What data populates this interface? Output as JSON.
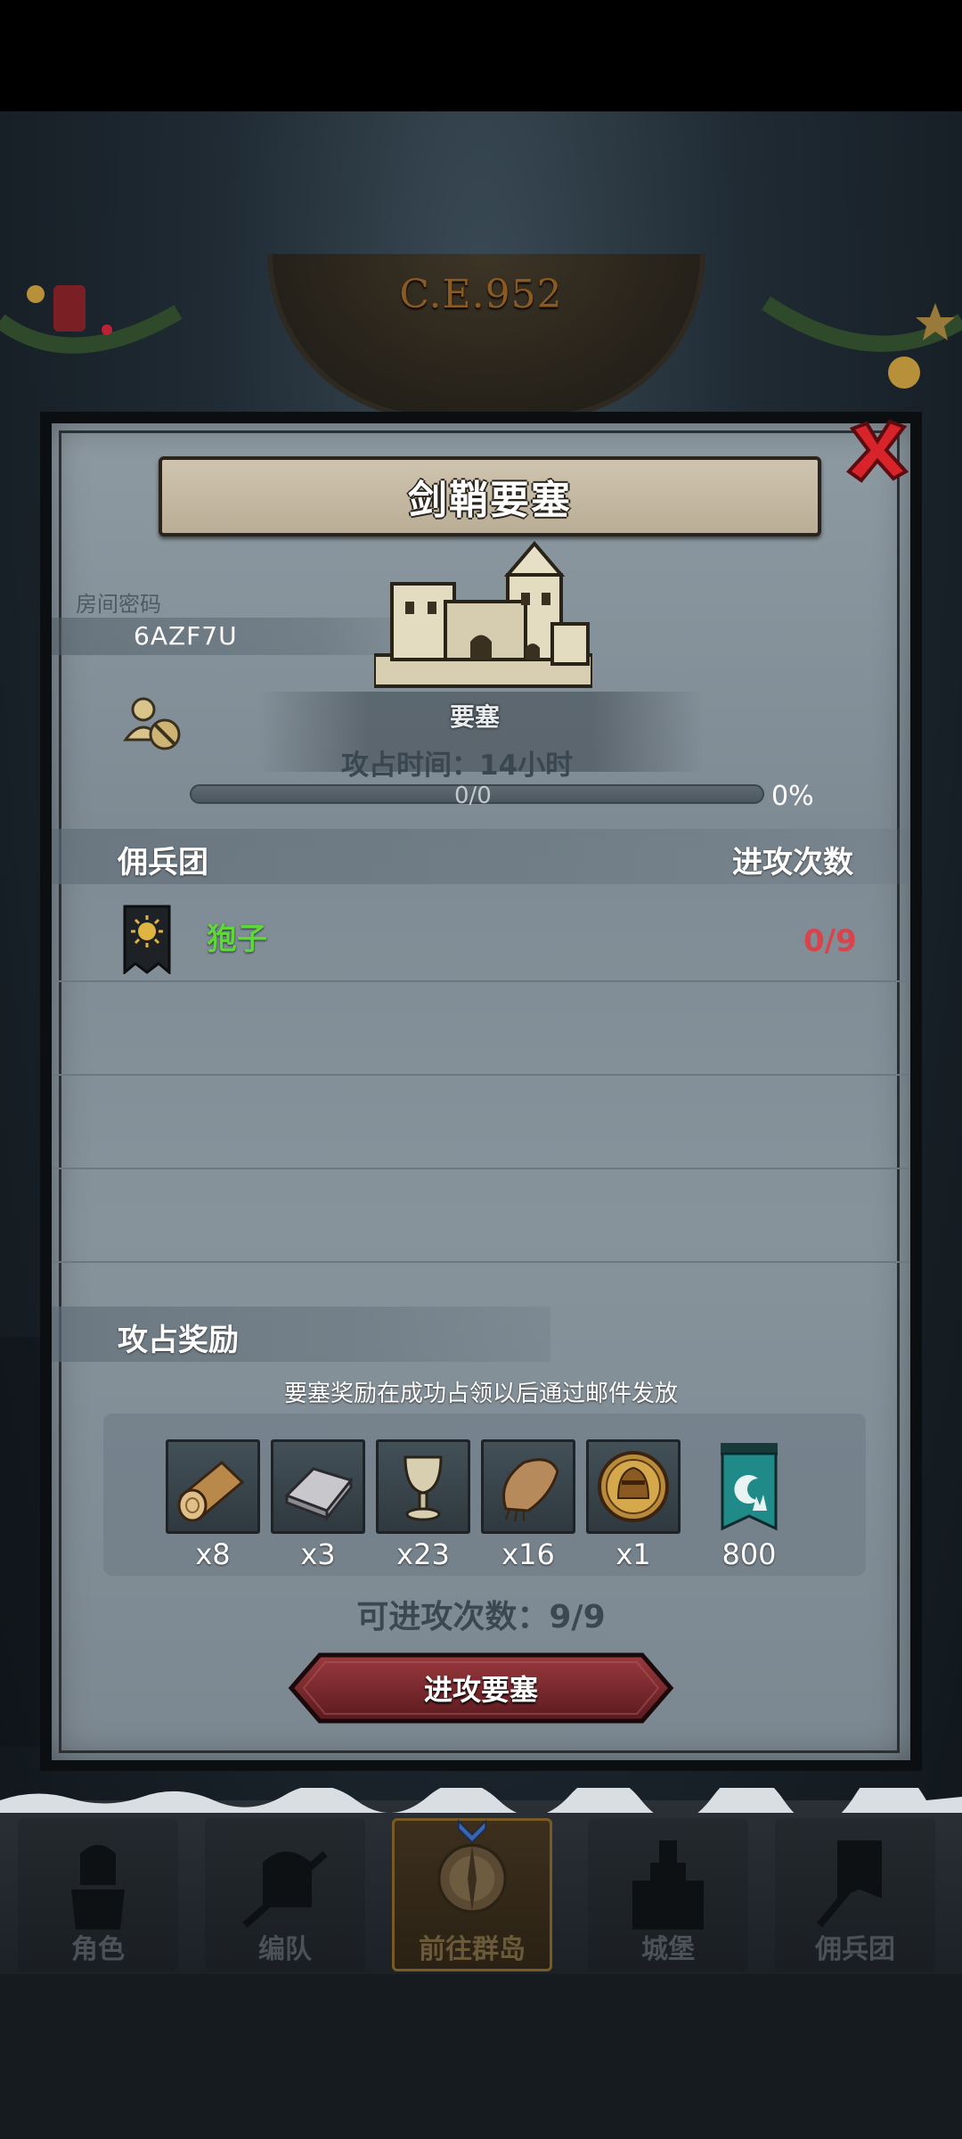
{
  "header": {
    "year": "C.E.952"
  },
  "dialog": {
    "title": "剑鞘要塞",
    "room": {
      "label": "房间密码",
      "code": "6AZF7U"
    },
    "info": {
      "type": "要塞",
      "occupy_time": "攻占时间：14小时",
      "progress_count": "0/0",
      "progress_pct": "0%",
      "progress_value": 0
    },
    "mercenary_section": {
      "title": "佣兵团",
      "attack_header": "进攻次数",
      "rows": [
        {
          "name": "狍子",
          "count": "0/9"
        }
      ]
    },
    "rewards": {
      "title": "攻占奖励",
      "note": "要塞奖励在成功占领以后通过邮件发放",
      "items": [
        {
          "icon": "wood-log-icon",
          "qty": "x8"
        },
        {
          "icon": "iron-ingot-icon",
          "qty": "x3"
        },
        {
          "icon": "goblet-icon",
          "qty": "x23"
        },
        {
          "icon": "fur-pelt-icon",
          "qty": "x16"
        },
        {
          "icon": "knight-medal-icon",
          "qty": "x1"
        },
        {
          "icon": "guild-banner-icon",
          "qty": "800"
        }
      ]
    },
    "attacks_left": "可进攻次数：9/9",
    "attack_button": "进攻要塞"
  },
  "nav": [
    {
      "label": "角色"
    },
    {
      "label": "编队"
    },
    {
      "label": "前往群岛"
    },
    {
      "label": "城堡"
    },
    {
      "label": "佣兵团"
    }
  ],
  "colors": {
    "merc_name": "#5fd63a",
    "attack_count": "#d9434b",
    "button_red": "#7a2a2e"
  }
}
